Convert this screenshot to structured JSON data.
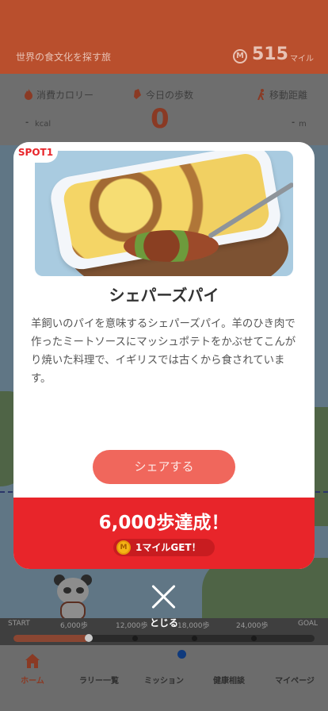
{
  "header": {
    "title": "世界の食文化を探す旅",
    "mile_icon": "M",
    "miles": "515",
    "mile_unit": "マイル"
  },
  "stats": {
    "calories_label": "消費カロリー",
    "calories_value": "-",
    "calories_unit": "kcal",
    "steps_label": "今日の歩数",
    "steps_value": "0",
    "distance_label": "移動距離",
    "distance_value": "-",
    "distance_unit": "m"
  },
  "progress": {
    "labels": [
      "START",
      "6,000歩",
      "12,000歩",
      "18,000歩",
      "24,000歩",
      "GOAL"
    ],
    "fill_fraction": 0.25
  },
  "tabs": [
    "ホーム",
    "ラリー一覧",
    "ミッション",
    "健康相談",
    "マイページ"
  ],
  "modal": {
    "spot_label": "SPOT1",
    "dish_name": "シェパーズパイ",
    "description": "羊飼いのパイを意味するシェパーズパイ。羊のひき肉で作ったミートソースにマッシュポテトをかぶせてこんがり焼いた料理で、イギリスでは古くから食されています。",
    "share_label": "シェアする",
    "achievement_title": "6,000歩達成！",
    "reward_coin": "M",
    "reward_label": "1マイルGET！"
  },
  "close_label": "とじる",
  "colors": {
    "brand": "#e8252a",
    "share": "#f0675c",
    "header": "#b94f2d"
  }
}
